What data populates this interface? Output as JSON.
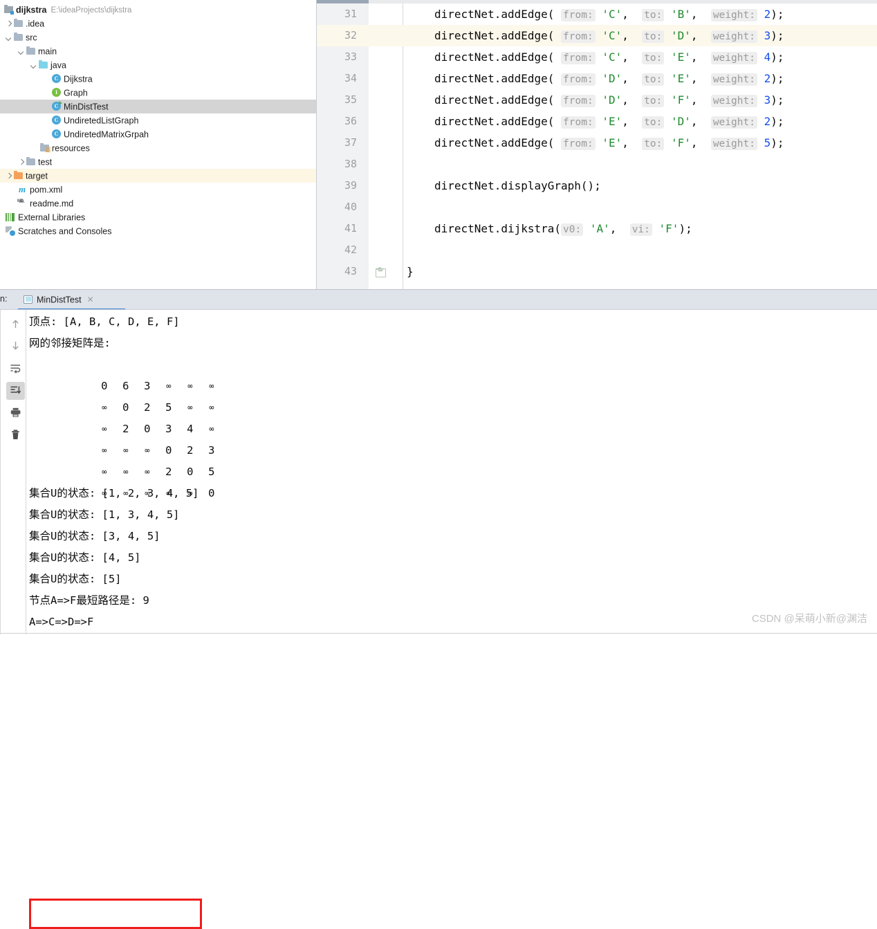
{
  "project": {
    "root": {
      "name": "dijkstra",
      "path": "E:\\ideaProjects\\dijkstra"
    },
    "items": [
      {
        "label": ".idea",
        "icon": "folder-icon",
        "indent": 1,
        "arrow": "right",
        "kind": "folder"
      },
      {
        "label": "src",
        "icon": "folder-icon",
        "indent": 1,
        "arrow": "down",
        "kind": "folder"
      },
      {
        "label": "main",
        "icon": "folder-icon",
        "indent": 2,
        "arrow": "down",
        "kind": "folder"
      },
      {
        "label": "java",
        "icon": "folder-blue-icon",
        "indent": 3,
        "arrow": "down",
        "kind": "source-folder"
      },
      {
        "label": "Dijkstra",
        "icon": "java-class-icon",
        "indent": 4,
        "arrow": "none",
        "kind": "class"
      },
      {
        "label": "Graph",
        "icon": "java-interface-icon",
        "indent": 4,
        "arrow": "none",
        "kind": "interface"
      },
      {
        "label": "MinDistTest",
        "icon": "java-runnable-class-icon",
        "indent": 4,
        "arrow": "none",
        "kind": "class",
        "selected": true
      },
      {
        "label": "UndiretedListGraph",
        "icon": "java-class-icon",
        "indent": 4,
        "arrow": "none",
        "kind": "class"
      },
      {
        "label": "UndiretedMatrixGrpah",
        "icon": "java-class-icon",
        "indent": 4,
        "arrow": "none",
        "kind": "class"
      },
      {
        "label": "resources",
        "icon": "resources-folder-icon",
        "indent": 3,
        "arrow": "none",
        "kind": "folder"
      },
      {
        "label": "test",
        "icon": "folder-icon",
        "indent": 2,
        "arrow": "right",
        "kind": "folder"
      },
      {
        "label": "target",
        "icon": "folder-orange-icon",
        "indent": 1,
        "arrow": "right",
        "kind": "folder",
        "highlight": true
      },
      {
        "label": "pom.xml",
        "icon": "maven-icon",
        "indent": 1,
        "arrow": "none",
        "kind": "file"
      },
      {
        "label": "readme.md",
        "icon": "markdown-icon",
        "indent": 1,
        "arrow": "none",
        "kind": "file"
      },
      {
        "label": "External Libraries",
        "icon": "libraries-icon",
        "indent": 0,
        "arrow": "none",
        "kind": "node"
      },
      {
        "label": "Scratches and Consoles",
        "icon": "scratches-icon",
        "indent": 0,
        "arrow": "none",
        "kind": "node"
      }
    ]
  },
  "editor": {
    "lines": [
      {
        "num": "31",
        "obj": "directNet",
        "method": ".addEdge(",
        "p1": "from:",
        "v1": "'C'",
        "p2": "to:",
        "v2": "'B'",
        "p3": "weight:",
        "v3": "2",
        "tail": ");",
        "highlight": false
      },
      {
        "num": "32",
        "obj": "directNet",
        "method": ".addEdge(",
        "p1": "from:",
        "v1": "'C'",
        "p2": "to:",
        "v2": "'D'",
        "p3": "weight:",
        "v3": "3",
        "tail": ");",
        "highlight": true
      },
      {
        "num": "33",
        "obj": "directNet",
        "method": ".addEdge(",
        "p1": "from:",
        "v1": "'C'",
        "p2": "to:",
        "v2": "'E'",
        "p3": "weight:",
        "v3": "4",
        "tail": ");",
        "highlight": false
      },
      {
        "num": "34",
        "obj": "directNet",
        "method": ".addEdge(",
        "p1": "from:",
        "v1": "'D'",
        "p2": "to:",
        "v2": "'E'",
        "p3": "weight:",
        "v3": "2",
        "tail": ");",
        "highlight": false
      },
      {
        "num": "35",
        "obj": "directNet",
        "method": ".addEdge(",
        "p1": "from:",
        "v1": "'D'",
        "p2": "to:",
        "v2": "'F'",
        "p3": "weight:",
        "v3": "3",
        "tail": ");",
        "highlight": false
      },
      {
        "num": "36",
        "obj": "directNet",
        "method": ".addEdge(",
        "p1": "from:",
        "v1": "'E'",
        "p2": "to:",
        "v2": "'D'",
        "p3": "weight:",
        "v3": "2",
        "tail": ");",
        "highlight": false
      },
      {
        "num": "37",
        "obj": "directNet",
        "method": ".addEdge(",
        "p1": "from:",
        "v1": "'E'",
        "p2": "to:",
        "v2": "'F'",
        "p3": "weight:",
        "v3": "5",
        "tail": ");",
        "highlight": false
      },
      {
        "num": "38",
        "blank": true
      },
      {
        "num": "39",
        "plain": "directNet.displayGraph();"
      },
      {
        "num": "40",
        "blank": true
      },
      {
        "num": "41",
        "obj": "directNet",
        "method": ".dijkstra(",
        "p1": "v0:",
        "v1": "'A'",
        "p2": "vi:",
        "v2": "'F'",
        "tail": ");"
      },
      {
        "num": "42",
        "blank": true
      },
      {
        "num": "43",
        "plain": "}",
        "fold": true
      }
    ]
  },
  "console": {
    "run_label": "n:",
    "tab": {
      "name": "MinDistTest",
      "close": "✕"
    },
    "toolbar": [
      {
        "name": "scroll-up-icon",
        "active": false
      },
      {
        "name": "scroll-down-icon",
        "active": false
      },
      {
        "name": "soft-wrap-icon",
        "active": false
      },
      {
        "name": "scroll-to-end-icon",
        "active": true
      },
      {
        "name": "print-icon",
        "active": false
      },
      {
        "name": "clear-all-icon",
        "active": false
      }
    ],
    "output": {
      "vertices_line": "顶点: [A, B, C, D, E, F]",
      "matrix_header": "网的邻接矩阵是:",
      "matrix": [
        [
          "0",
          "6",
          "3",
          "∞",
          "∞",
          "∞"
        ],
        [
          "∞",
          "0",
          "2",
          "5",
          "∞",
          "∞"
        ],
        [
          "∞",
          "2",
          "0",
          "3",
          "4",
          "∞"
        ],
        [
          "∞",
          "∞",
          "∞",
          "0",
          "2",
          "3"
        ],
        [
          "∞",
          "∞",
          "∞",
          "2",
          "0",
          "5"
        ],
        [
          "∞",
          "∞",
          "∞",
          "∞",
          "∞",
          "0"
        ]
      ],
      "set_lines": [
        "集合U的状态: [1, 2, 3, 4, 5]",
        "集合U的状态: [1, 3, 4, 5]",
        "集合U的状态: [3, 4, 5]",
        "集合U的状态: [4, 5]",
        "集合U的状态: [5]"
      ],
      "result_line": "节点A=>F最短路径是: 9",
      "path_line": "A=>C=>D=>F"
    }
  },
  "watermark": "CSDN @呆萌小新@渊洁",
  "colors": {
    "accent": "#3c81d6",
    "highlight_row": "#fdf8ec",
    "selection": "#d4d4d4",
    "annotation": "#ef1c1c",
    "string": "#1f8a2f",
    "number": "#1750eb"
  }
}
